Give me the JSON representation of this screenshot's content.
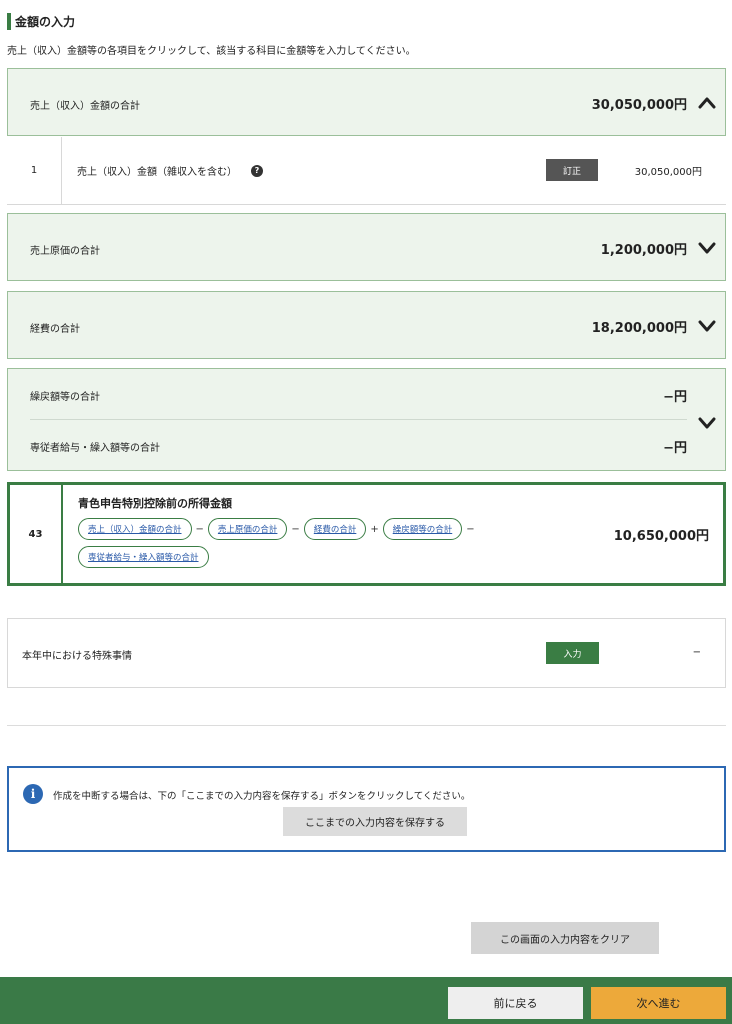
{
  "section": {
    "title": "金額の入力",
    "instruction": "売上（収入）金額等の各項目をクリックして、該当する科目に金額等を入力してください。"
  },
  "sales_total": {
    "label": "売上（収入）金額の合計",
    "amount": "30,050,000円",
    "expanded": true
  },
  "sales_row": {
    "number": "1",
    "label": "売上（収入）金額（雑収入を含む）",
    "help_icon": "?",
    "button": "訂正",
    "value": "30,050,000円"
  },
  "cost_total": {
    "label": "売上原価の合計",
    "amount": "1,200,000円"
  },
  "expense_total": {
    "label": "経費の合計",
    "amount": "18,200,000円"
  },
  "carryover": {
    "label1": "繰戻額等の合計",
    "amount1": "−円",
    "label2": "専従者給与・繰入額等の合計",
    "amount2": "−円"
  },
  "income": {
    "number": "43",
    "title": "青色申告特別控除前の所得金額",
    "terms": [
      "売上（収入）金額の合計",
      "売上原価の合計",
      "経費の合計",
      "繰戻額等の合計",
      "専従者給与・繰入額等の合計"
    ],
    "ops": [
      "−",
      "−",
      "+",
      "−"
    ],
    "total": "10,650,000円"
  },
  "special": {
    "label": "本年中における特殊事情",
    "button": "入力",
    "value": "−"
  },
  "info": {
    "icon": "i",
    "message": "作成を中断する場合は、下の「ここまでの入力内容を保存する」ボタンをクリックしてください。",
    "save_button": "ここまでの入力内容を保存する"
  },
  "clear_button": "この画面の入力内容をクリア",
  "footer": {
    "back": "前に戻る",
    "next": "次へ進む"
  },
  "colors": {
    "accent_green": "#3a7d44",
    "panel_bg": "#edf4ec",
    "info_blue": "#2c68b3",
    "next_orange": "#eda93a"
  }
}
